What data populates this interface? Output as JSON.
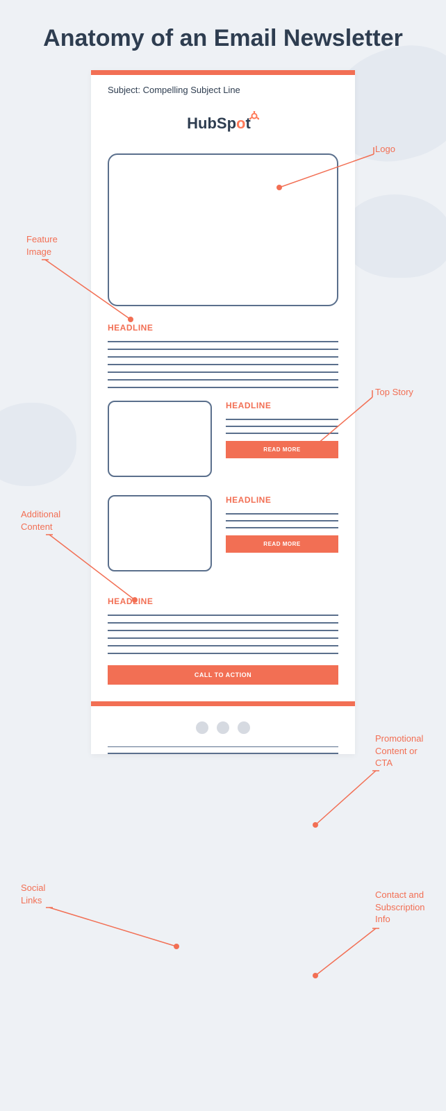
{
  "title": "Anatomy of an Email Newsletter",
  "subject": "Subject: Compelling Subject Line",
  "logo": {
    "part1": "HubSp",
    "o": "o",
    "part2": "t"
  },
  "headline": "HEADLINE",
  "read_more": "READ MORE",
  "cta": "CALL TO ACTION",
  "annotations": {
    "logo": "Logo",
    "feature_image": "Feature\nImage",
    "top_story": "Top Story",
    "additional_content": "Additional\nContent",
    "promo": "Promotional\nContent or\nCTA",
    "social_links": "Social\nLinks",
    "contact": "Contact and\nSubscription\nInfo"
  }
}
